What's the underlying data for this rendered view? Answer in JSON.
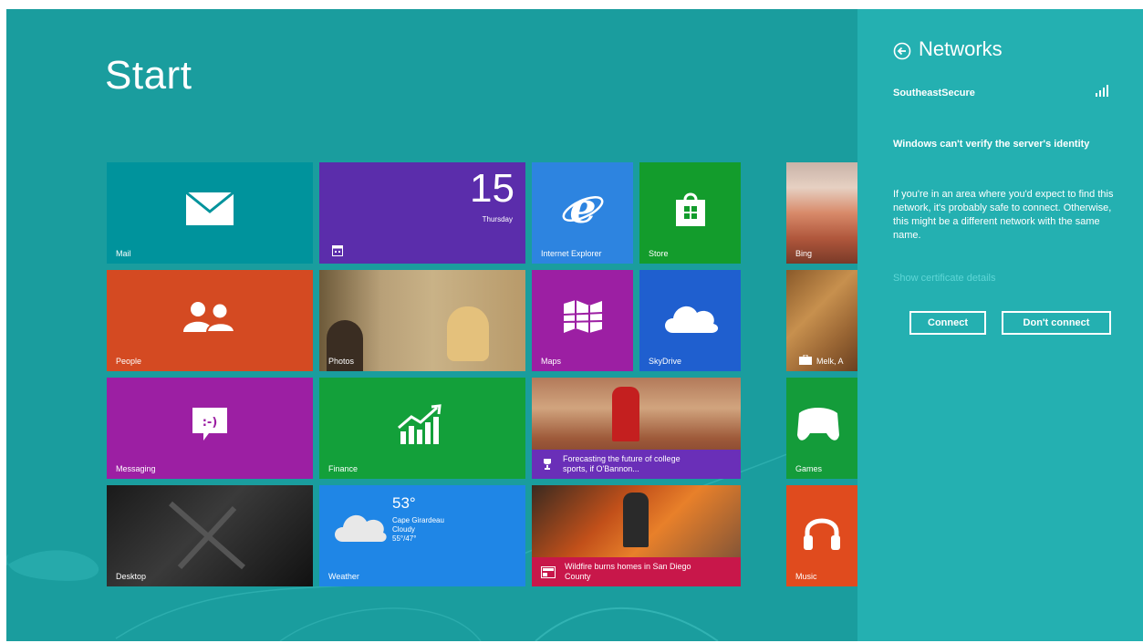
{
  "start": {
    "title": "Start"
  },
  "tiles": {
    "mail": {
      "label": "Mail"
    },
    "calendar": {
      "day_number": "15",
      "day_name": "Thursday"
    },
    "ie": {
      "label": "Internet Explorer"
    },
    "store": {
      "label": "Store"
    },
    "bing": {
      "label": "Bing"
    },
    "people": {
      "label": "People"
    },
    "photos": {
      "label": "Photos"
    },
    "maps": {
      "label": "Maps"
    },
    "skydrive": {
      "label": "SkyDrive"
    },
    "travel": {
      "label": "Melk, A"
    },
    "messaging": {
      "label": "Messaging"
    },
    "finance": {
      "label": "Finance"
    },
    "sports": {
      "headline": "Forecasting the future of college sports, if O'Bannon..."
    },
    "games": {
      "label": "Games"
    },
    "desktop": {
      "label": "Desktop"
    },
    "weather": {
      "label": "Weather",
      "temp": "53°",
      "city": "Cape Girardeau",
      "condition": "Cloudy",
      "range": "55°/47°"
    },
    "news": {
      "headline": "Wildfire burns homes in San Diego County"
    },
    "music": {
      "label": "Music"
    }
  },
  "network_panel": {
    "title": "Networks",
    "ssid": "SoutheastSecure",
    "heading": "Windows can't verify the server's identity",
    "body": "If you're in an area where you'd expect to find this network, it's probably safe to connect. Otherwise, this might be a different network with the same name.",
    "link": "Show certificate details",
    "connect_label": "Connect",
    "dont_connect_label": "Don't connect"
  },
  "colors": {
    "background": "#1a9d9e",
    "panel": "#24b0b1",
    "mail": "#00939c",
    "calendar": "#5b2dab",
    "ie": "#2d84e0",
    "store": "#139c2c",
    "people": "#d44a22",
    "maps": "#9c1fa3",
    "skydrive": "#1f5fcf",
    "messaging": "#9c1fa3",
    "finance": "#13a03a",
    "weather": "#1f86e6",
    "sports_bar": "#6a2fb8",
    "news_bar": "#c8174a",
    "games": "#149c3a",
    "music": "#e04b1e"
  }
}
